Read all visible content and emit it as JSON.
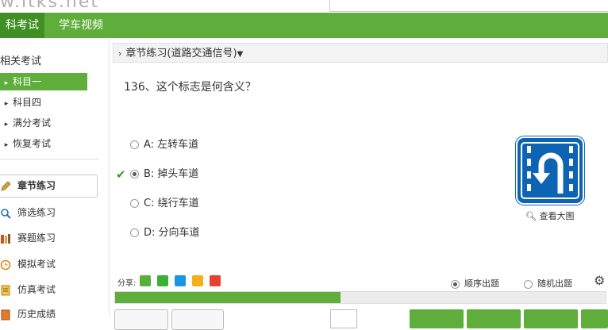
{
  "site": {
    "logo_text": "w.ltks.net"
  },
  "nav": {
    "tabs": [
      {
        "label": "科考试"
      },
      {
        "label": "学车视频"
      }
    ]
  },
  "sidebar": {
    "heading": "相关考试",
    "items": [
      {
        "label": "科目一"
      },
      {
        "label": "科目四"
      },
      {
        "label": "满分考试"
      },
      {
        "label": "恢复考试"
      }
    ],
    "links": [
      {
        "label": "章节练习"
      },
      {
        "label": "筛选练习"
      },
      {
        "label": "赛题练习"
      },
      {
        "label": "模拟考试"
      },
      {
        "label": "仿真考试"
      },
      {
        "label": "历史成绩"
      }
    ]
  },
  "breadcrumb": {
    "label": "章节练习(道路交通信号)"
  },
  "question": {
    "text": "136、这个标志是何含义？",
    "options": [
      {
        "label": "A: 左转车道"
      },
      {
        "label": "B: 掉头车道"
      },
      {
        "label": "C: 绕行车道"
      },
      {
        "label": "D: 分向车道"
      }
    ],
    "selected": "B"
  },
  "image_zoom_label": "查看大图",
  "share": {
    "label": "分享:"
  },
  "mode": {
    "sequential": "顺序出题",
    "random": "随机出题",
    "selected": "sequential"
  },
  "progress": {
    "fraction": 0.46
  },
  "colors": {
    "brand_green": "#5fad3a",
    "sign_blue": "#0e64b4"
  }
}
